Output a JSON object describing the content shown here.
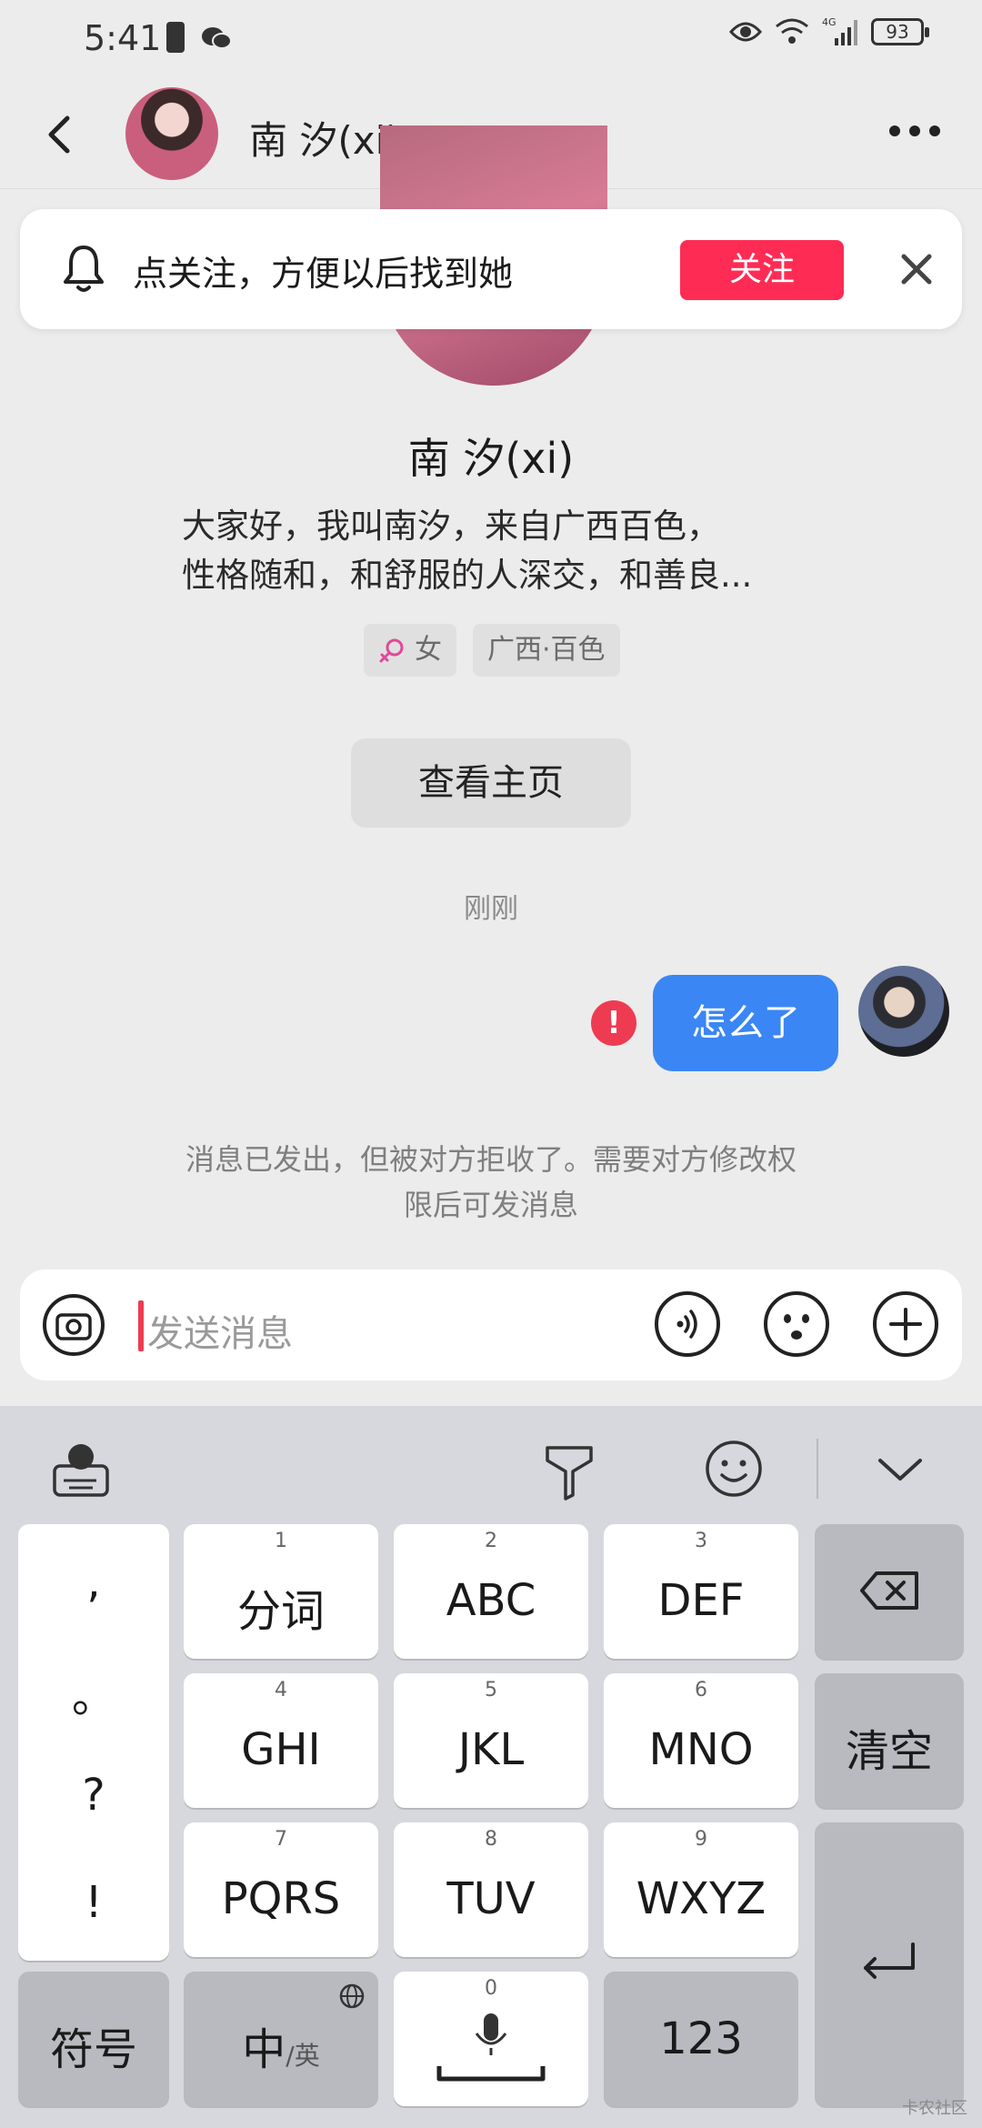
{
  "status_bar": {
    "time": "5:41",
    "battery": "93",
    "network": "4G"
  },
  "header": {
    "title": "南 汐(xi)"
  },
  "follow_banner": {
    "text": "点关注，方便以后找到她",
    "button": "关注"
  },
  "profile": {
    "name": "南 汐(xi)",
    "bio_line1": "大家好，我叫南汐，来自广西百色，",
    "bio_line2": "性格随和，和舒服的人深交，和善良...",
    "tag_gender": "女",
    "tag_location": "广西·百色",
    "home_button": "查看主页"
  },
  "chat": {
    "timestamp": "刚刚",
    "message": "怎么了",
    "error_mark": "!",
    "notice_line1": "消息已发出，但被对方拒收了。需要对方修改权",
    "notice_line2": "限后可发消息"
  },
  "input": {
    "placeholder": "发送消息"
  },
  "keyboard": {
    "punct": [
      ",",
      "。",
      "?",
      "!"
    ],
    "rows": [
      [
        {
          "num": "1",
          "label": "分词"
        },
        {
          "num": "2",
          "label": "ABC"
        },
        {
          "num": "3",
          "label": "DEF"
        }
      ],
      [
        {
          "num": "4",
          "label": "GHI"
        },
        {
          "num": "5",
          "label": "JKL"
        },
        {
          "num": "6",
          "label": "MNO"
        }
      ],
      [
        {
          "num": "7",
          "label": "PQRS"
        },
        {
          "num": "8",
          "label": "TUV"
        },
        {
          "num": "9",
          "label": "WXYZ"
        }
      ]
    ],
    "clear": "清空",
    "symbols": "符号",
    "lang_main": "中",
    "lang_sub": "/英",
    "space_num": "0",
    "num_key": "123"
  },
  "watermark": "卡农社区",
  "colors": {
    "accent_red": "#fe2c55",
    "bubble_blue": "#3a86f5",
    "error_red": "#ee3b52"
  }
}
